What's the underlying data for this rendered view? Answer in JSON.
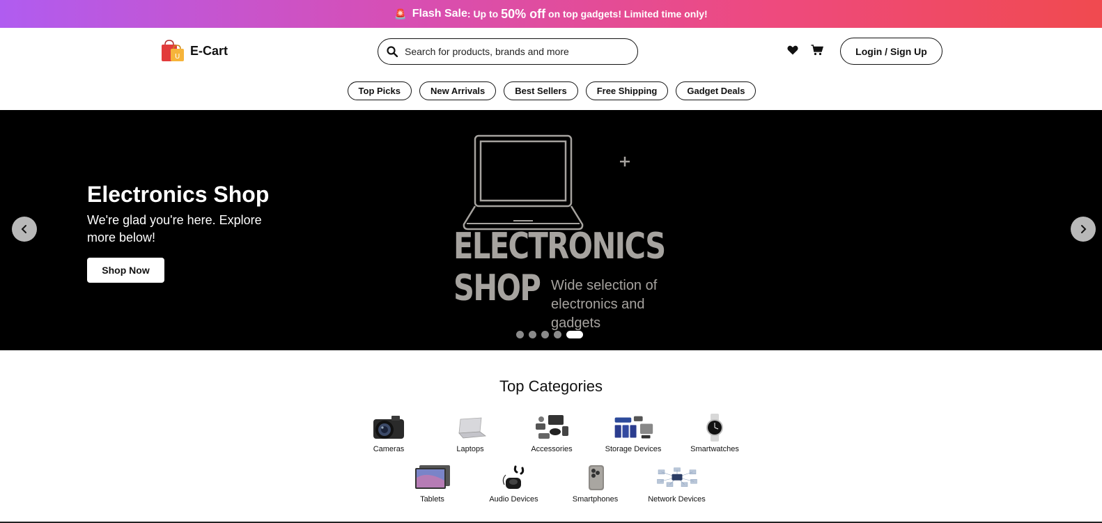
{
  "flash": {
    "alarm_icon": "alarm-light-icon",
    "label_strong": "Flash Sale",
    "label_rest": ": Up to ",
    "discount": "50% off",
    "tail": " on top gadgets! Limited time only!"
  },
  "header": {
    "brand": "E-Cart",
    "search_placeholder": "Search for products, brands and more",
    "login_label": "Login / Sign Up"
  },
  "pills": [
    "Top Picks",
    "New Arrivals",
    "Best Sellers",
    "Free Shipping",
    "Gadget Deals"
  ],
  "hero": {
    "title": "Electronics Shop",
    "subtitle": "We're glad you're here. Explore more below!",
    "cta": "Shop Now",
    "art_line1": "ELECTRONICS",
    "art_line2": "SHOP",
    "art_tagline": "Wide selection of electronics and gadgets",
    "slides_total": 5,
    "active_slide": 5
  },
  "categories": {
    "title": "Top Categories",
    "row1": [
      {
        "label": "Cameras",
        "icon": "camera-icon"
      },
      {
        "label": "Laptops",
        "icon": "laptop-icon"
      },
      {
        "label": "Accessories",
        "icon": "accessories-icon"
      },
      {
        "label": "Storage Devices",
        "icon": "storage-icon"
      },
      {
        "label": "Smartwatches",
        "icon": "smartwatch-icon"
      }
    ],
    "row2": [
      {
        "label": "Tablets",
        "icon": "tablet-icon"
      },
      {
        "label": "Audio Devices",
        "icon": "earbuds-icon"
      },
      {
        "label": "Smartphones",
        "icon": "smartphone-icon"
      },
      {
        "label": "Network Devices",
        "icon": "network-icon"
      }
    ]
  },
  "colors": {
    "banner_start": "#b05cf0",
    "banner_end": "#f04a4f",
    "hero_bg": "#000000",
    "art_gray": "#a6a39f"
  }
}
